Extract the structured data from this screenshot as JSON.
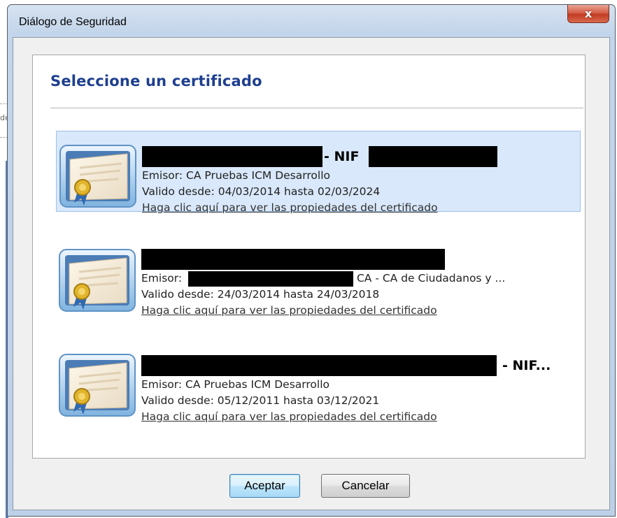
{
  "window": {
    "title": "Diálogo de Seguridad",
    "close_glyph": "x"
  },
  "background_fragment": "de",
  "dialog": {
    "heading": "Seleccione un certificado",
    "certificates": [
      {
        "title_suffix": "- NIF",
        "issuer_label": "Emisor:",
        "issuer_text": "CA Pruebas ICM Desarrollo",
        "validity": "Valido desde: 04/03/2014 hasta 02/03/2024",
        "link": "Haga clic aquí para ver las propiedades del certificado",
        "selected": true,
        "icon": "certificate-icon"
      },
      {
        "title_suffix": "",
        "issuer_label": "Emisor:",
        "issuer_text": "CA - CA de Ciudadanos y ...",
        "validity": "Valido desde: 24/03/2014 hasta 24/03/2018",
        "link": "Haga clic aquí para ver las propiedades del certificado",
        "selected": false,
        "icon": "certificate-icon"
      },
      {
        "title_suffix": "- NIF...",
        "issuer_label": "Emisor:",
        "issuer_text": "CA Pruebas ICM Desarrollo",
        "validity": "Valido desde: 05/12/2011 hasta 03/12/2021",
        "link": "Haga clic aquí para ver las propiedades del certificado",
        "selected": false,
        "icon": "certificate-icon"
      }
    ],
    "buttons": {
      "accept": "Aceptar",
      "cancel": "Cancelar"
    }
  },
  "colors": {
    "heading": "#1e3f8f",
    "selection": "#d9e8fb",
    "close_button": "#c33b23"
  }
}
